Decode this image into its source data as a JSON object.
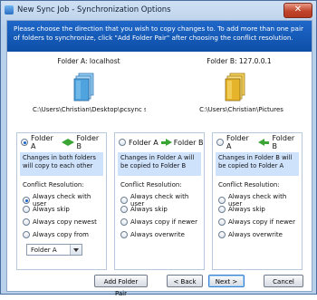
{
  "window": {
    "title": "New Sync Job - Synchronization Options"
  },
  "header": {
    "text": "Please choose the direction that you wish to copy changes to. To add more than one pair of folders to synchronize, click \"Add Folder Pair\" after choosing the conflict resolution."
  },
  "folders": {
    "a": {
      "title": "Folder A: localhost",
      "path": "C:\\Users\\Christian\\Desktop\\pcsync sc...",
      "icon": "folder-icon-blue"
    },
    "b": {
      "title": "Folder B: 127.0.0.1",
      "path": "C:\\Users\\Christian\\Pictures",
      "icon": "folder-icon-yellow"
    }
  },
  "panels": [
    {
      "left": "Folder A",
      "right": "Folder B",
      "arrow": "both",
      "selected": true,
      "description": "Changes in both folders will copy to each other",
      "conflict_label": "Conflict Resolution:",
      "options": [
        "Always check with user",
        "Always skip",
        "Always copy newest",
        "Always copy from"
      ],
      "selected_option": 0,
      "dropdown_value": "Folder A"
    },
    {
      "left": "Folder A",
      "right": "Folder B",
      "arrow": "right",
      "selected": false,
      "description": "Changes in Folder A will be copied to Folder B",
      "conflict_label": "Conflict Resolution:",
      "options": [
        "Always check with user",
        "Always skip",
        "Always copy if newer",
        "Always overwrite"
      ],
      "selected_option": 0
    },
    {
      "left": "Folder A",
      "right": "Folder B",
      "arrow": "left",
      "selected": false,
      "description": "Changes in Folder B will be copied to Folder A",
      "conflict_label": "Conflict Resolution:",
      "options": [
        "Always check with user",
        "Always skip",
        "Always copy if newer",
        "Always overwrite"
      ],
      "selected_option": 0
    }
  ],
  "buttons": {
    "add_pair": "Add Folder Pair",
    "back": "< Back",
    "next": "Next >",
    "cancel": "Cancel"
  },
  "colors": {
    "header": "#1f67c8",
    "description_bg": "#cfe2fb",
    "arrow": "#3aa535"
  }
}
